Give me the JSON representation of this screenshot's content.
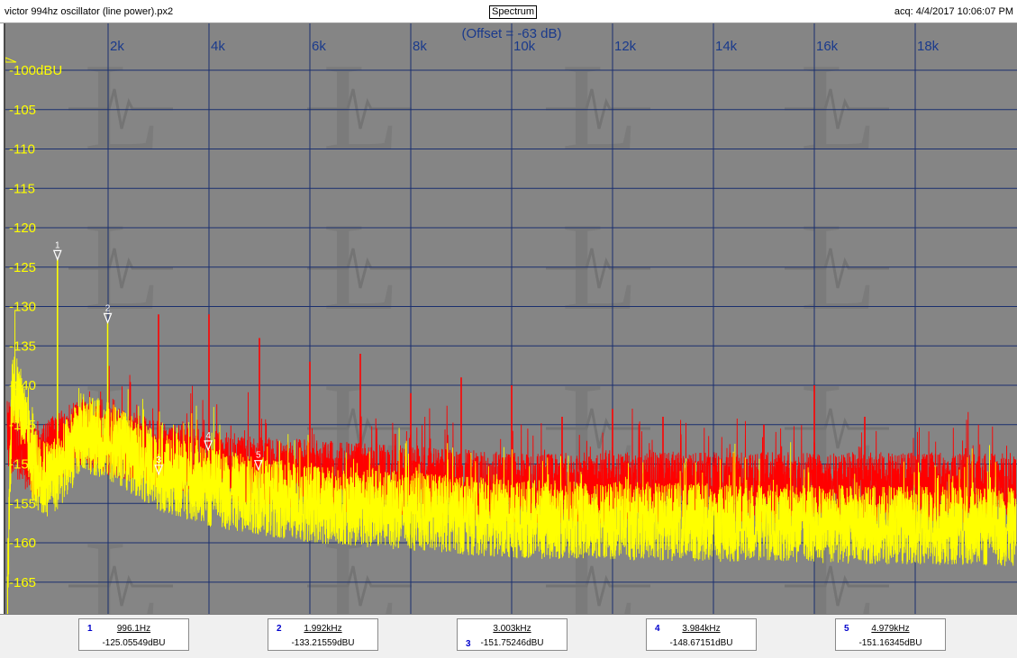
{
  "window": {
    "file_title": "victor 994hz oscillator (line power).px2",
    "mode_label": "Spectrum",
    "acquired": "acq: 4/4/2017 10:06:07 PM"
  },
  "chart_data": {
    "type": "line",
    "offset_label": "(Offset = -63 dB)",
    "x_unit": "Hz",
    "xlim": [
      0,
      20000
    ],
    "ylim": [
      -168,
      -98
    ],
    "x_ticks": [
      "2k",
      "4k",
      "6k",
      "8k",
      "10k",
      "12k",
      "14k",
      "16k",
      "18k"
    ],
    "x_tick_values": [
      2000,
      4000,
      6000,
      8000,
      10000,
      12000,
      14000,
      16000,
      18000
    ],
    "y_ticks": [
      "-100dBU",
      "-105",
      "-110",
      "-115",
      "-120",
      "-125",
      "-130",
      "-135",
      "-140",
      "-145",
      "-150",
      "-155",
      "-160",
      "-165"
    ],
    "y_tick_values": [
      -100,
      -105,
      -110,
      -115,
      -120,
      -125,
      -130,
      -135,
      -140,
      -145,
      -150,
      -155,
      -160,
      -165
    ],
    "grid": true,
    "colors": {
      "background": "#858585",
      "grid": "#1a2f6e",
      "series_yellow": "#ffff00",
      "series_red": "#ff0000",
      "axis_text_y": "#ffff00",
      "axis_text_x": "#1a3a8c"
    },
    "series": [
      {
        "color": "#ff0000",
        "noise_floor_dbu": [
          [
            0,
            -146
          ],
          [
            500,
            -150
          ],
          [
            1500,
            -146
          ],
          [
            3000,
            -149
          ],
          [
            5000,
            -151
          ],
          [
            10000,
            -153
          ],
          [
            20000,
            -153
          ]
        ],
        "spikes": [
          [
            3000,
            -131
          ],
          [
            4000,
            -131
          ],
          [
            5000,
            -134
          ],
          [
            6000,
            -137
          ],
          [
            7000,
            -136
          ],
          [
            8000,
            -141
          ],
          [
            9000,
            -139
          ],
          [
            10000,
            -140
          ],
          [
            11000,
            -144
          ],
          [
            12000,
            -143
          ],
          [
            13000,
            -144
          ],
          [
            15000,
            -145
          ],
          [
            16000,
            -140
          ],
          [
            17000,
            -144
          ],
          [
            18000,
            -149
          ],
          [
            19000,
            -148
          ]
        ]
      },
      {
        "color": "#ffff00",
        "noise_floor_dbu": [
          [
            0,
            -168
          ],
          [
            100,
            -140
          ],
          [
            300,
            -143
          ],
          [
            500,
            -150
          ],
          [
            700,
            -152
          ],
          [
            1000,
            -151
          ],
          [
            1500,
            -146
          ],
          [
            2000,
            -147
          ],
          [
            3000,
            -151
          ],
          [
            4000,
            -153
          ],
          [
            6000,
            -155
          ],
          [
            10000,
            -157
          ],
          [
            20000,
            -158
          ]
        ],
        "spikes": [
          [
            996.1,
            -124
          ],
          [
            1992,
            -132
          ]
        ]
      }
    ],
    "markers": [
      {
        "id": "1",
        "freq_hz": 996.1,
        "level_dbu": -125.05549,
        "freq_label": "996.1Hz",
        "level_label": "-125.05549dBU"
      },
      {
        "id": "2",
        "freq_hz": 1992,
        "level_dbu": -133.21559,
        "freq_label": "1.992kHz",
        "level_label": "-133.21559dBU"
      },
      {
        "id": "3",
        "freq_hz": 3003,
        "level_dbu": -151.75246,
        "freq_label": "3.003kHz",
        "level_label": "-151.75246dBU"
      },
      {
        "id": "4",
        "freq_hz": 3984,
        "level_dbu": -148.67151,
        "freq_label": "3.984kHz",
        "level_label": "-148.67151dBU"
      },
      {
        "id": "5",
        "freq_hz": 4979,
        "level_dbu": -151.16345,
        "freq_label": "4.979kHz",
        "level_label": "-151.16345dBU"
      }
    ]
  }
}
